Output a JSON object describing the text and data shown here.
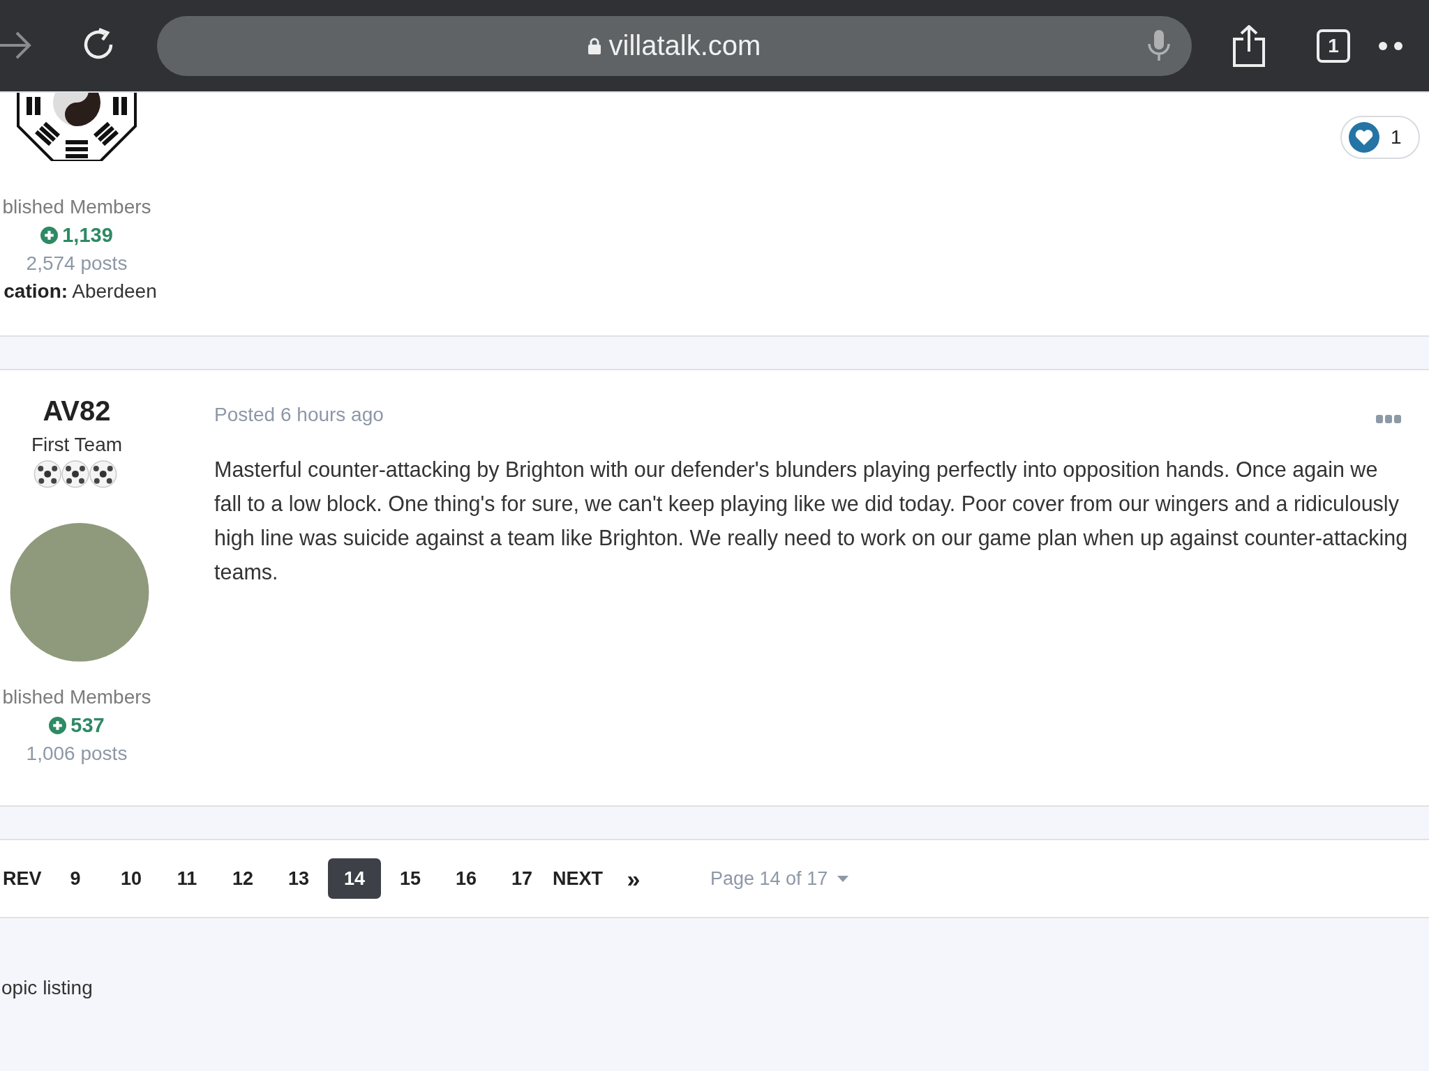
{
  "browser": {
    "url": "villatalk.com",
    "tab_count": "1"
  },
  "posts": [
    {
      "avatar": {
        "kind": "emblem"
      },
      "group": "blished Members",
      "reputation": "1,139",
      "post_count": "2,574 posts",
      "location_label": "cation:",
      "location": "Aberdeen",
      "likes": "1"
    },
    {
      "author": "AV82",
      "rank": "First Team",
      "avatar": {
        "kind": "photo"
      },
      "group": "blished Members",
      "reputation": "537",
      "post_count": "1,006 posts",
      "date": "Posted 6 hours ago",
      "body": "Masterful counter-attacking by Brighton with our defender's blunders playing perfectly into opposition hands. Once again we fall to a low block. One thing's for sure, we can't keep playing like we did today. Poor cover from our wingers and a ridiculously high line was suicide against a team like Brighton. We really need to work on our game plan when up against counter-attacking teams."
    }
  ],
  "pagination": {
    "pages": [
      {
        "label": "REV",
        "selected": false
      },
      {
        "label": "9",
        "selected": false
      },
      {
        "label": "10",
        "selected": false
      },
      {
        "label": "11",
        "selected": false
      },
      {
        "label": "12",
        "selected": false
      },
      {
        "label": "13",
        "selected": false
      },
      {
        "label": "14",
        "selected": true
      },
      {
        "label": "15",
        "selected": false
      },
      {
        "label": "16",
        "selected": false
      },
      {
        "label": "17",
        "selected": false
      },
      {
        "label": "NEXT",
        "selected": false
      },
      {
        "label": "»",
        "selected": false
      }
    ],
    "jump": "Page 14 of 17"
  },
  "footer": {
    "link": "opic listing"
  }
}
